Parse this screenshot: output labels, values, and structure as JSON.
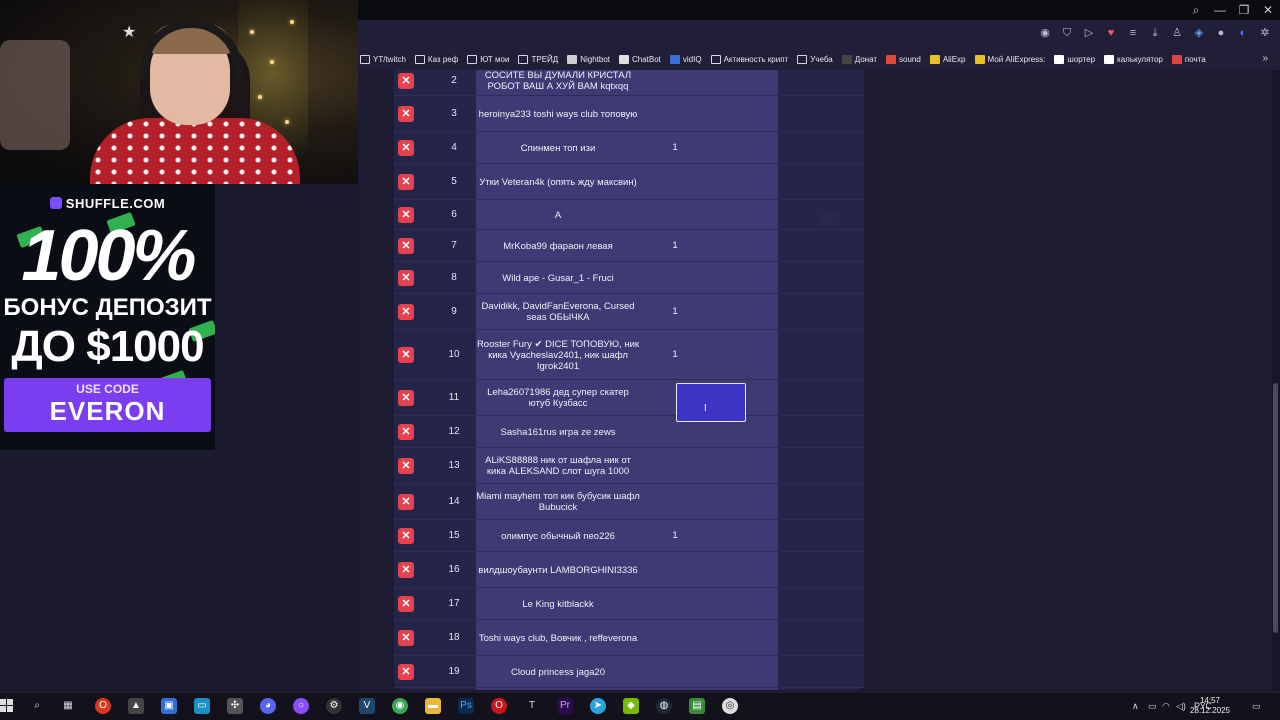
{
  "bookmarks": [
    {
      "label": "YT/twitch",
      "icon": "folder-icon",
      "color": "#d6d6e6"
    },
    {
      "label": "Каз реф",
      "icon": "folder-icon",
      "color": "#d6d6e6"
    },
    {
      "label": "ЮТ мои",
      "icon": "folder-icon",
      "color": "#d6d6e6"
    },
    {
      "label": "ТРЕЙД",
      "icon": "folder-icon",
      "color": "#d6d6e6"
    },
    {
      "label": "Nightbot",
      "icon": "nightbot-icon",
      "color": "#cfcfcf"
    },
    {
      "label": "ChatBot",
      "icon": "chatbot-icon",
      "color": "#e0e0e0"
    },
    {
      "label": "vidIQ",
      "icon": "vidiq-icon",
      "color": "#3b6fd8"
    },
    {
      "label": "Активность крипт",
      "icon": "folder-icon",
      "color": "#d6d6e6"
    },
    {
      "label": "Учеба",
      "icon": "folder-icon",
      "color": "#d6d6e6"
    },
    {
      "label": "Донат",
      "icon": "donat-icon",
      "color": "#444"
    },
    {
      "label": "sound",
      "icon": "sound-icon",
      "color": "#e04a3a"
    },
    {
      "label": "AliExp",
      "icon": "aliexp-icon",
      "color": "#e8c02a"
    },
    {
      "label": "Мой AliExpress:",
      "icon": "aliexpress-icon",
      "color": "#e8c02a"
    },
    {
      "label": "шортер",
      "icon": "google-icon",
      "color": "#ffffff"
    },
    {
      "label": "калькулятор",
      "icon": "google-icon",
      "color": "#ffffff"
    },
    {
      "label": "почта",
      "icon": "mail-icon",
      "color": "#d44"
    }
  ],
  "ad": {
    "brand": "SHUFFLE.COM",
    "headline": "100%",
    "line1": "БОНУС ДЕПОЗИТ",
    "line2": "ДО $1000",
    "use_code": "USE CODE",
    "code": "EVERON"
  },
  "table": {
    "rows": [
      {
        "num": "2",
        "name": "СОСИТЕ ВЫ ДУМАЛИ КРИСТАЛ РОБОТ ВАШ А ХУЙ ВАМ kqtxqq",
        "value": ""
      },
      {
        "num": "3",
        "name": "heroinya233 toshi ways club топовую",
        "value": ""
      },
      {
        "num": "4",
        "name": "Спинмен топ изи",
        "value": "1"
      },
      {
        "num": "5",
        "name": "Утки Veteran4k (опять жду максвин)",
        "value": ""
      },
      {
        "num": "6",
        "name": "А",
        "value": ""
      },
      {
        "num": "7",
        "name": "MrKoba99 фараон левая",
        "value": "1"
      },
      {
        "num": "8",
        "name": "Wild ape - Gusar_1 - Fruci",
        "value": ""
      },
      {
        "num": "9",
        "name": "Davidikk, DavidFanEverona, Cursed seas ОБЫЧКА",
        "value": "1"
      },
      {
        "num": "10",
        "name": "Rooster Fury ✔ DICE ТОПОВУЮ, ник кика Vyacheslav2401, ник шафл Igrok2401",
        "value": "1"
      },
      {
        "num": "11",
        "name": "Leha26071986 дед супер скатер ютуб Кузбасс",
        "value": ""
      },
      {
        "num": "12",
        "name": "Sasha161rus игра ze zews",
        "value": ""
      },
      {
        "num": "13",
        "name": "ALiKS88888 ник от шафла ник от кика ALEKSAND слот шуга 1000",
        "value": ""
      },
      {
        "num": "14",
        "name": "Miami mayhem топ кик бубусик шафл Bubucick",
        "value": ""
      },
      {
        "num": "15",
        "name": "олимпус обычный neo226",
        "value": "1"
      },
      {
        "num": "16",
        "name": "вилдшоубаунти LAMBORGHINI3336",
        "value": ""
      },
      {
        "num": "17",
        "name": "Le King kitblackk",
        "value": ""
      },
      {
        "num": "18",
        "name": "Toshi ways club, Вовчик , reffeverona",
        "value": ""
      },
      {
        "num": "19",
        "name": "Cloud princess jaga20",
        "value": ""
      }
    ]
  },
  "tray": {
    "lang": "РУС",
    "time": "14:57",
    "date": "28.12.2025"
  },
  "colors": {
    "delete": "#e5424d",
    "active_cell": "#3b34c4",
    "panel": "#252449",
    "name_column": "#3e3a74"
  }
}
